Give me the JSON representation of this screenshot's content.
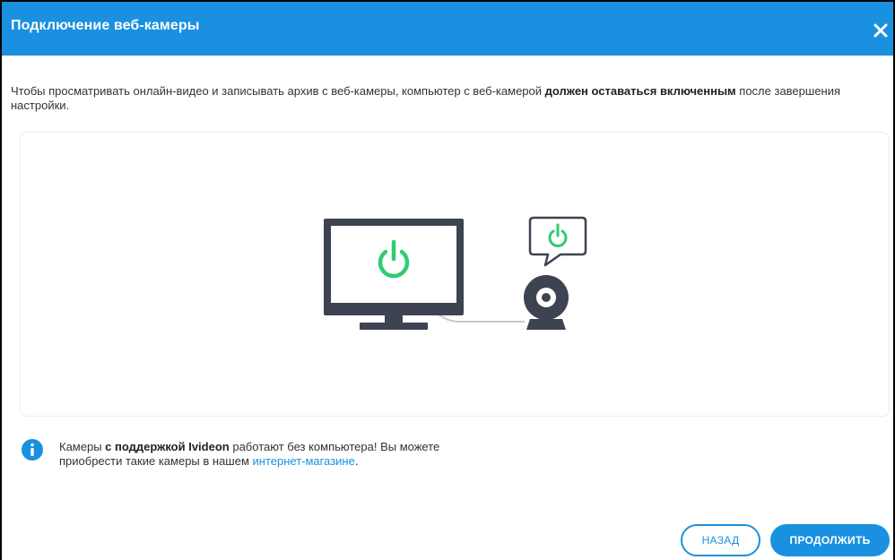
{
  "dialog": {
    "title": "Подключение веб-камеры",
    "close_icon": "close-icon"
  },
  "intro": {
    "text_before": "Чтобы просматривать онлайн-видео и записывать архив с веб-камеры, компьютер с веб-камерой ",
    "text_bold": "должен оставаться включенным",
    "text_after": " после завершения настройки."
  },
  "illustration": {
    "icons": [
      "monitor-icon",
      "power-icon",
      "webcam-icon",
      "speech-bubble-icon"
    ],
    "colors": {
      "device": "#3d4350",
      "power": "#2ecc71",
      "cable": "#c8c8c8"
    }
  },
  "info": {
    "icon": "info-icon",
    "part1": "Камеры ",
    "part2_bold": "с поддержкой Ivideon",
    "part3": " работают без компьютера! Вы можете",
    "part4": "приобрести такие камеры в нашем ",
    "link_text": "интернет-магазине",
    "part5": "."
  },
  "buttons": {
    "back_label": "НАЗАД",
    "continue_label": "ПРОДОЛЖИТЬ"
  },
  "colors": {
    "accent": "#1a90e0",
    "text": "#333333"
  }
}
